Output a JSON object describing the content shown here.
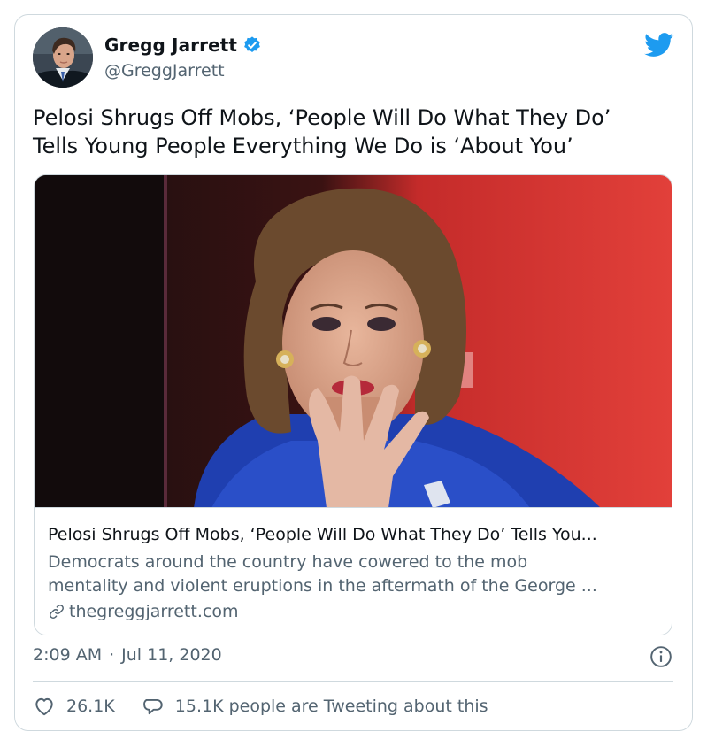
{
  "author": {
    "display_name": "Gregg Jarrett",
    "handle": "@GreggJarrett",
    "verified": true,
    "avatar_icon": "avatar-photo"
  },
  "tweet": {
    "text_line1": "Pelosi Shrugs Off Mobs, ‘People Will Do What They Do’",
    "text_line2": "Tells Young People Everything We Do is ‘About You’"
  },
  "link_card": {
    "title": "Pelosi Shrugs Off Mobs, ‘People Will Do What They Do’ Tells You...",
    "description_line1": "Democrats around the country have cowered to the mob",
    "description_line2": "mentality and violent eruptions in the aftermath of the George ...",
    "domain": "thegreggjarrett.com",
    "image_icon": "article-photo"
  },
  "meta": {
    "time": "2:09 AM",
    "separator": "·",
    "date": "Jul 11, 2020"
  },
  "actions": {
    "likes": "26.1K",
    "replies_text": "15.1K people are Tweeting about this"
  },
  "colors": {
    "twitter_blue": "#1d9bf0",
    "text_primary": "#0f1419",
    "text_secondary": "#536471",
    "border": "#cfd9de"
  }
}
